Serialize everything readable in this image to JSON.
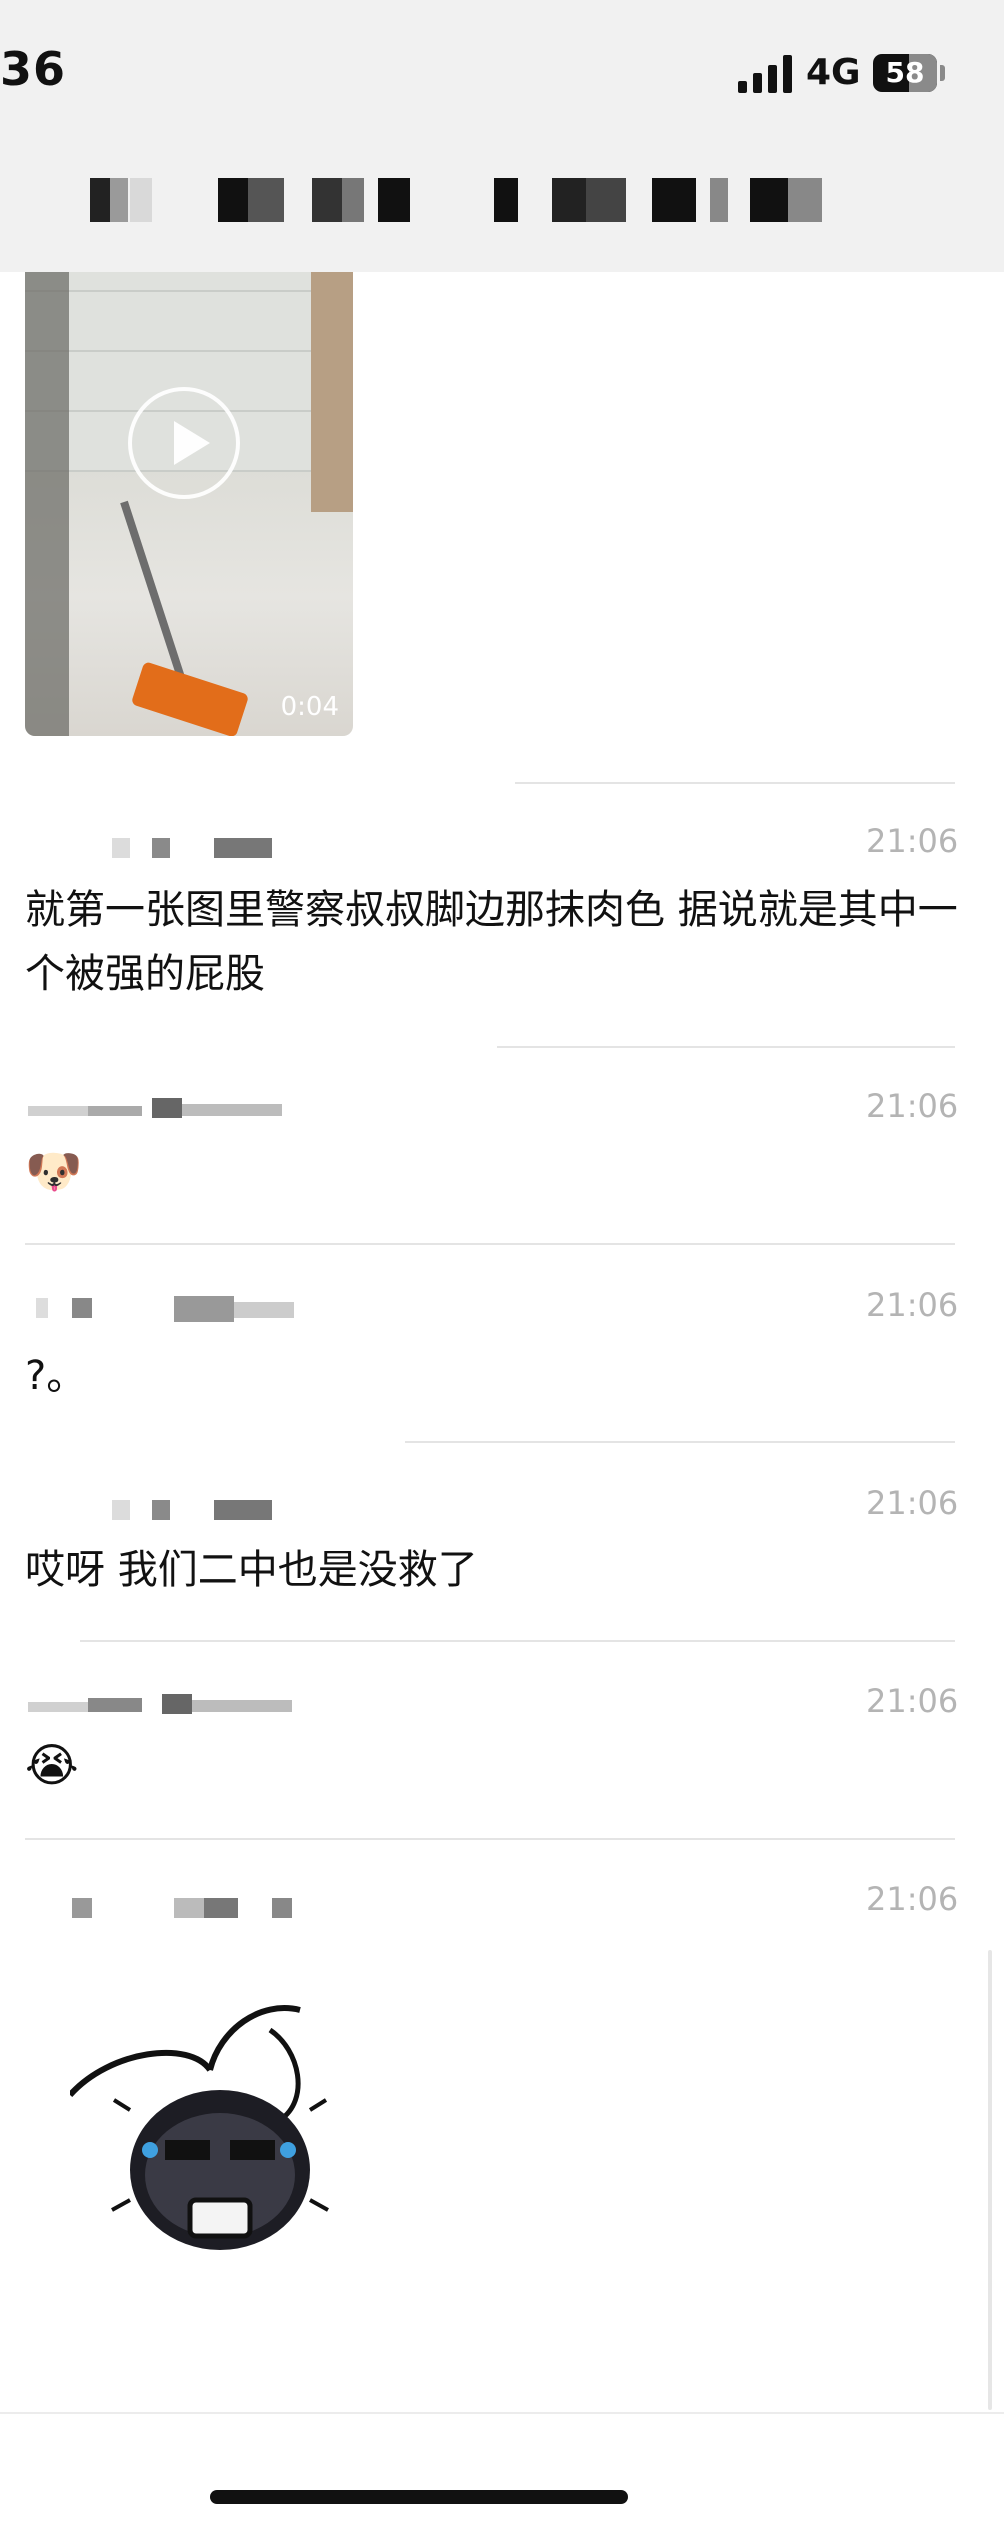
{
  "status_bar": {
    "time": "36",
    "network": "4G",
    "battery": "58"
  },
  "video": {
    "duration": "0:04"
  },
  "messages": [
    {
      "time": "21:06",
      "text": "就第一张图里警察叔叔脚边那抹肉色 据说就是其中一个被强的屁股"
    },
    {
      "time": "21:06",
      "emoji": "🐶"
    },
    {
      "time": "21:06",
      "text": "?。"
    },
    {
      "time": "21:06",
      "text": "哎呀 我们二中也是没救了"
    },
    {
      "time": "21:06",
      "emoji": "😭"
    },
    {
      "time": "21:06"
    }
  ]
}
